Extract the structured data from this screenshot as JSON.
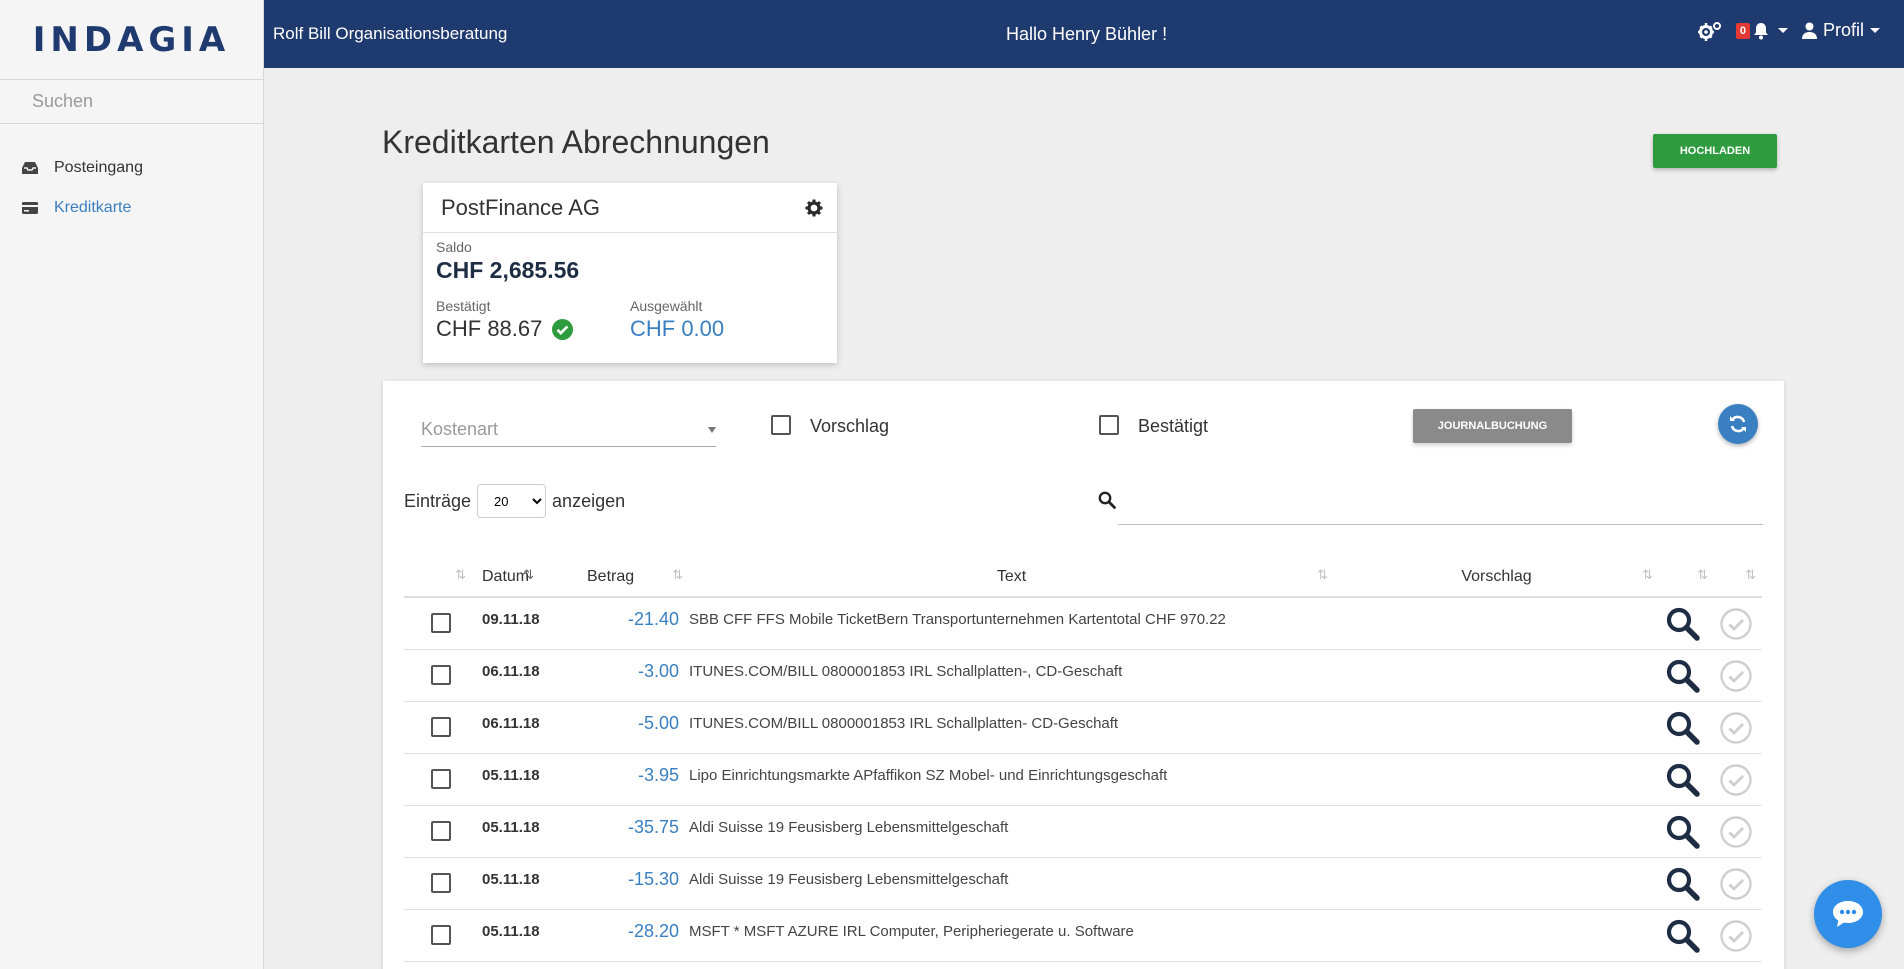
{
  "sidebar": {
    "logo": "INDAGIA",
    "search_placeholder": "Suchen",
    "items": [
      {
        "label": "Posteingang",
        "icon": "inbox-icon"
      },
      {
        "label": "Kreditkarte",
        "icon": "credit-card-icon"
      }
    ]
  },
  "topbar": {
    "organisation": "Rolf Bill Organisationsberatung",
    "greeting": "Hallo Henry Bühler !",
    "notification_count": "0",
    "profile_label": "Profil"
  },
  "main": {
    "title": "Kreditkarten Abrechnungen",
    "upload_label": "HOCHLADEN",
    "card": {
      "name": "PostFinance AG",
      "saldo_label": "Saldo",
      "saldo_value": "CHF 2,685.56",
      "confirmed_label": "Bestätigt",
      "confirmed_value": "CHF 88.67",
      "selected_label": "Ausgewählt",
      "selected_value": "CHF 0.00"
    },
    "filters": {
      "kostenart_placeholder": "Kostenart",
      "vorschlag_label": "Vorschlag",
      "bestaetigt_label": "Bestätigt",
      "journal_label": "JOURNALBUCHUNG"
    },
    "entries": {
      "prefix": "Einträge",
      "value": "20",
      "suffix": "anzeigen"
    },
    "table": {
      "headers": [
        "",
        "Datum",
        "Betrag",
        "Text",
        "Vorschlag",
        "",
        ""
      ],
      "rows": [
        {
          "date": "09.11.18",
          "amount": "-21.40",
          "text": "SBB CFF FFS Mobile TicketBern Transportunternehmen Kartentotal CHF 970.22",
          "vorschlag": ""
        },
        {
          "date": "06.11.18",
          "amount": "-3.00",
          "text": "ITUNES.COM/BILL 0800001853 IRL Schallplatten-, CD-Geschaft",
          "vorschlag": ""
        },
        {
          "date": "06.11.18",
          "amount": "-5.00",
          "text": "ITUNES.COM/BILL 0800001853 IRL Schallplatten- CD-Geschaft",
          "vorschlag": ""
        },
        {
          "date": "05.11.18",
          "amount": "-3.95",
          "text": "Lipo Einrichtungsmarkte APfaffikon SZ Mobel- und Einrichtungsgeschaft",
          "vorschlag": ""
        },
        {
          "date": "05.11.18",
          "amount": "-35.75",
          "text": "Aldi Suisse 19 Feusisberg Lebensmittelgeschaft",
          "vorschlag": ""
        },
        {
          "date": "05.11.18",
          "amount": "-15.30",
          "text": "Aldi Suisse 19 Feusisberg Lebensmittelgeschaft",
          "vorschlag": ""
        },
        {
          "date": "05.11.18",
          "amount": "-28.20",
          "text": "MSFT * MSFT AZURE IRL Computer, Peripheriegerate u. Software",
          "vorschlag": ""
        }
      ]
    }
  },
  "colors": {
    "topbar": "#1f3a6e",
    "accent": "#3a7fc1",
    "upload_button": "#2e9b3f",
    "confirmed_check": "#2e9b3f",
    "badge": "#e53935"
  }
}
